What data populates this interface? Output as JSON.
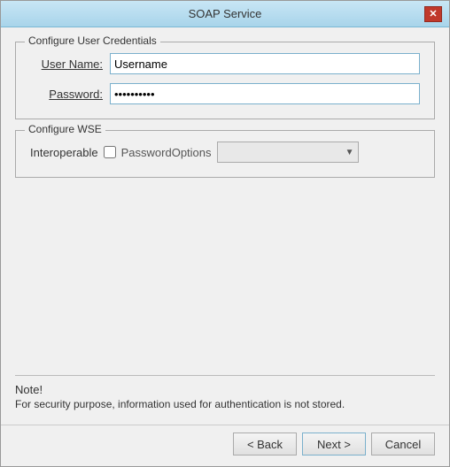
{
  "window": {
    "title": "SOAP Service",
    "close_label": "✕"
  },
  "credentials_group": {
    "label": "Configure User Credentials",
    "username_label": "User Name:",
    "username_underline_char": "U",
    "username_value": "Username",
    "password_label": "Password:",
    "password_underline_char": "P",
    "password_value": "••••••••••"
  },
  "wse_group": {
    "label": "Configure WSE",
    "interoperable_label": "Interoperable",
    "password_options_label": "PasswordOptions",
    "dropdown_value": ""
  },
  "note": {
    "title": "Note!",
    "text": "For security purpose, information used for authentication is not stored."
  },
  "buttons": {
    "back_label": "< Back",
    "next_label": "Next >",
    "cancel_label": "Cancel"
  }
}
